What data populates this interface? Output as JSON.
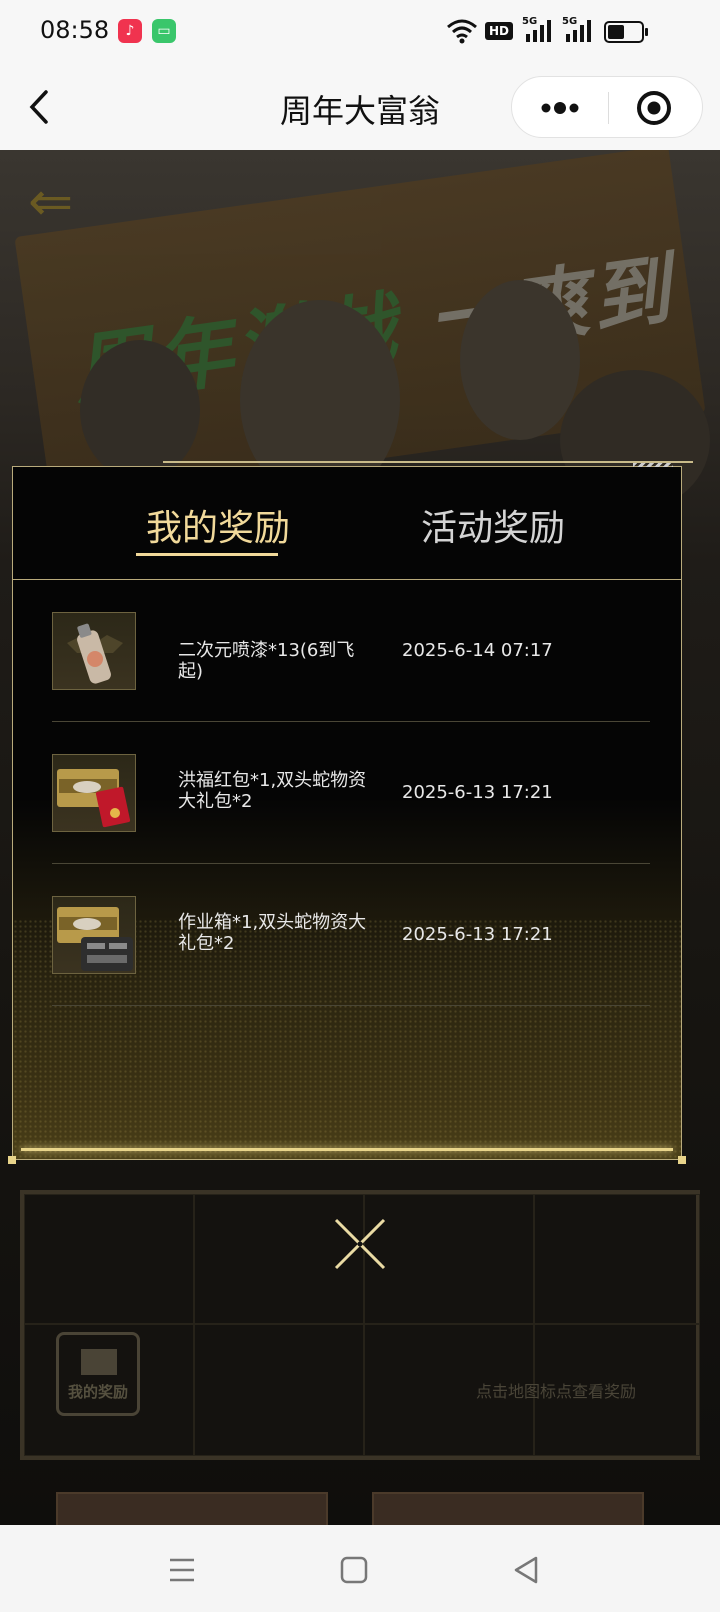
{
  "status_bar": {
    "time": "08:58",
    "icons": [
      "music-app-icon",
      "message-app-icon",
      "wifi-icon",
      "hd-icon",
      "signal-5g-icon",
      "signal-5g-icon",
      "battery-icon"
    ],
    "hd_label": "HD",
    "net_label": "5G"
  },
  "title_bar": {
    "title": "周年大富翁"
  },
  "background": {
    "banner_text_green": "周年激战",
    "banner_text_white": "一爽到底",
    "gift_label": "我的奖励",
    "map_hint": "点击地图标点查看奖励"
  },
  "modal": {
    "tabs": [
      {
        "label": "我的奖励",
        "active": true
      },
      {
        "label": "活动奖励",
        "active": false
      }
    ],
    "rewards": [
      {
        "name": "二次元喷漆*13(6到飞起)",
        "date": "2025-6-14 07:17",
        "icon": "spray-paint-icon"
      },
      {
        "name": "洪福红包*1,双头蛇物资大礼包*2",
        "date": "2025-6-13 17:21",
        "icon": "red-envelope-crate-icon"
      },
      {
        "name": "作业箱*1,双头蛇物资大礼包*2",
        "date": "2025-6-13 17:21",
        "icon": "toolbox-crate-icon"
      }
    ]
  },
  "colors": {
    "accent_gold": "#f1d99a",
    "modal_border": "#b9ab7c",
    "glow": "#e8d48a"
  }
}
